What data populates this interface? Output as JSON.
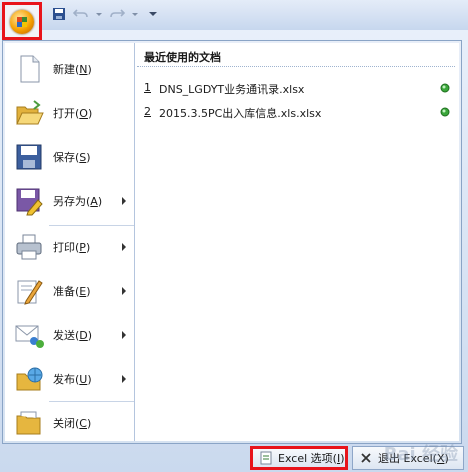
{
  "menu": {
    "items": [
      {
        "label": "新建(",
        "key": "N",
        "tail": ")",
        "icon": "new-document-icon",
        "arrow": false
      },
      {
        "label": "打开(",
        "key": "O",
        "tail": ")",
        "icon": "open-folder-icon",
        "arrow": false
      },
      {
        "label": "保存(",
        "key": "S",
        "tail": ")",
        "icon": "save-disk-icon",
        "arrow": false
      },
      {
        "label": "另存为(",
        "key": "A",
        "tail": ")",
        "icon": "save-as-icon",
        "arrow": true
      },
      {
        "label": "打印(",
        "key": "P",
        "tail": ")",
        "icon": "printer-icon",
        "arrow": true
      },
      {
        "label": "准备(",
        "key": "E",
        "tail": ")",
        "icon": "prepare-pencil-icon",
        "arrow": true
      },
      {
        "label": "发送(",
        "key": "D",
        "tail": ")",
        "icon": "send-mail-icon",
        "arrow": true
      },
      {
        "label": "发布(",
        "key": "U",
        "tail": ")",
        "icon": "publish-folder-icon",
        "arrow": true
      },
      {
        "label": "关闭(",
        "key": "C",
        "tail": ")",
        "icon": "close-folder-icon",
        "arrow": false
      }
    ]
  },
  "recent": {
    "title": "最近使用的文档",
    "documents": [
      {
        "num": "1",
        "name": "DNS_LGDYT业务通讯录.xlsx"
      },
      {
        "num": "2",
        "name": "2015.3.5PC出入库信息.xls.xlsx"
      }
    ]
  },
  "bottom": {
    "options_label": "Excel 选项(",
    "options_key": "I",
    "options_tail": ")",
    "exit_label": "退出 Excel(",
    "exit_key": "X",
    "exit_tail": ")"
  },
  "watermark": "Bai 经验",
  "colors": {
    "highlight_border": "#e8141b",
    "pin_green": "#3aa63a"
  }
}
